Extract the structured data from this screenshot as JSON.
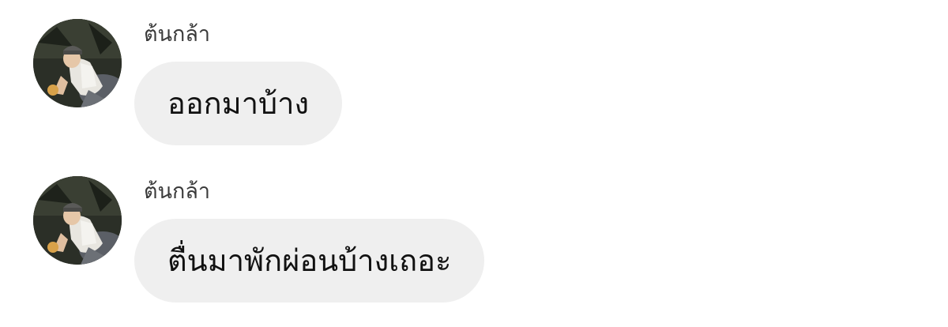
{
  "messages": [
    {
      "sender": "ต้นกล้า",
      "avatar_icon": "profile-photo-avatar",
      "text": "ออกมาบ้าง"
    },
    {
      "sender": "ต้นกล้า",
      "avatar_icon": "profile-photo-avatar",
      "text": "ตื่นมาพักผ่อนบ้างเถอะ"
    }
  ],
  "colors": {
    "background": "#ffffff",
    "bubble": "#efefef",
    "text": "#111111",
    "sender": "#3a3a3a"
  }
}
